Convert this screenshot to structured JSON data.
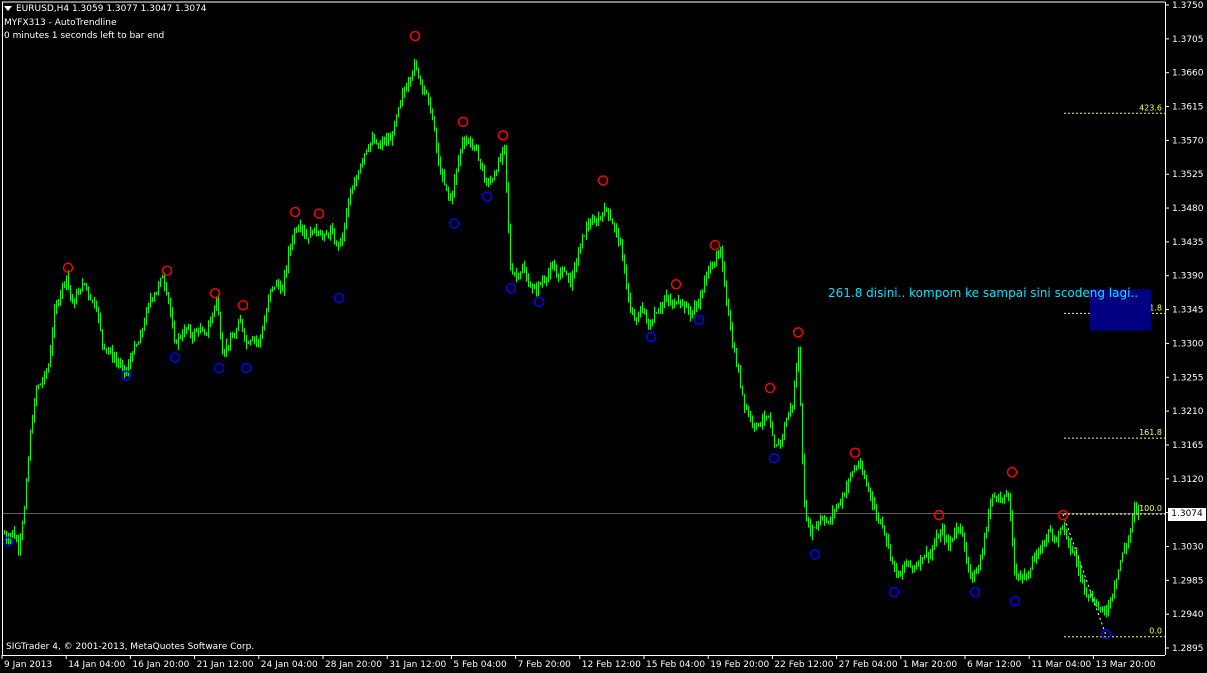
{
  "header": {
    "symbol_line": "EURUSD,H4  1.3059 1.3077 1.3047 1.3074",
    "indicator": "MYFX313 - AutoTrendline",
    "timer": "0 minutes 1 seconds left to bar end"
  },
  "copyright": "SIGTrader 4, © 2001-2013, MetaQuotes Software Corp.",
  "annotation": "261.8 disini.. kompom ke sampai sini scodeng lagi..",
  "last_price_label": "1.3074",
  "colors": {
    "background": "#000000",
    "candles": "#00ff00",
    "swing_high": "#ff0000",
    "swing_low": "#0000ff",
    "fib": "#ffff66",
    "annotation": "#00e5ff",
    "box": "#000080"
  },
  "chart_data": {
    "type": "line",
    "style": "candlestick",
    "ylim": [
      1.2895,
      1.375
    ],
    "y_ticks": [
      "1.3750",
      "1.3705",
      "1.3660",
      "1.3615",
      "1.3570",
      "1.3525",
      "1.3480",
      "1.3435",
      "1.3390",
      "1.3345",
      "1.3300",
      "1.3255",
      "1.3210",
      "1.3165",
      "1.3120",
      "1.3075",
      "1.3030",
      "1.2985",
      "1.2940",
      "1.2895"
    ],
    "x_ticks": [
      "9 Jan 2013",
      "14 Jan 04:00",
      "16 Jan 20:00",
      "21 Jan 12:00",
      "24 Jan 04:00",
      "28 Jan 20:00",
      "31 Jan 12:00",
      "5 Feb 04:00",
      "7 Feb 20:00",
      "12 Feb 12:00",
      "15 Feb 04:00",
      "19 Feb 20:00",
      "22 Feb 12:00",
      "27 Feb 04:00",
      "1 Mar 20:00",
      "6 Mar 12:00",
      "11 Mar 04:00",
      "13 Mar 20:00"
    ],
    "close_series": [
      [
        0,
        1.306
      ],
      [
        6,
        1.304
      ],
      [
        12,
        1.305
      ],
      [
        18,
        1.303
      ],
      [
        24,
        1.308
      ],
      [
        30,
        1.318
      ],
      [
        36,
        1.324
      ],
      [
        42,
        1.325
      ],
      [
        48,
        1.327
      ],
      [
        54,
        1.334
      ],
      [
        60,
        1.337
      ],
      [
        66,
        1.339
      ],
      [
        72,
        1.335
      ],
      [
        78,
        1.337
      ],
      [
        84,
        1.338
      ],
      [
        90,
        1.336
      ],
      [
        96,
        1.335
      ],
      [
        102,
        1.33
      ],
      [
        108,
        1.329
      ],
      [
        114,
        1.328
      ],
      [
        120,
        1.327
      ],
      [
        126,
        1.326
      ],
      [
        132,
        1.329
      ],
      [
        138,
        1.33
      ],
      [
        144,
        1.333
      ],
      [
        150,
        1.336
      ],
      [
        156,
        1.337
      ],
      [
        162,
        1.339
      ],
      [
        168,
        1.336
      ],
      [
        174,
        1.33
      ],
      [
        180,
        1.331
      ],
      [
        186,
        1.332
      ],
      [
        192,
        1.331
      ],
      [
        198,
        1.332
      ],
      [
        204,
        1.331
      ],
      [
        210,
        1.333
      ],
      [
        216,
        1.336
      ],
      [
        222,
        1.329
      ],
      [
        228,
        1.33
      ],
      [
        234,
        1.331
      ],
      [
        240,
        1.333
      ],
      [
        246,
        1.33
      ],
      [
        252,
        1.331
      ],
      [
        258,
        1.33
      ],
      [
        264,
        1.333
      ],
      [
        270,
        1.337
      ],
      [
        276,
        1.338
      ],
      [
        282,
        1.337
      ],
      [
        288,
        1.342
      ],
      [
        294,
        1.345
      ],
      [
        300,
        1.346
      ],
      [
        306,
        1.344
      ],
      [
        312,
        1.345
      ],
      [
        318,
        1.345
      ],
      [
        324,
        1.344
      ],
      [
        330,
        1.345
      ],
      [
        336,
        1.343
      ],
      [
        342,
        1.344
      ],
      [
        348,
        1.349
      ],
      [
        354,
        1.351
      ],
      [
        360,
        1.354
      ],
      [
        366,
        1.356
      ],
      [
        372,
        1.357
      ],
      [
        378,
        1.356
      ],
      [
        384,
        1.357
      ],
      [
        390,
        1.357
      ],
      [
        396,
        1.36
      ],
      [
        402,
        1.363
      ],
      [
        408,
        1.365
      ],
      [
        414,
        1.367
      ],
      [
        420,
        1.365
      ],
      [
        426,
        1.363
      ],
      [
        432,
        1.36
      ],
      [
        438,
        1.354
      ],
      [
        444,
        1.351
      ],
      [
        450,
        1.349
      ],
      [
        456,
        1.353
      ],
      [
        462,
        1.357
      ],
      [
        468,
        1.357
      ],
      [
        474,
        1.356
      ],
      [
        480,
        1.354
      ],
      [
        486,
        1.351
      ],
      [
        492,
        1.352
      ],
      [
        498,
        1.354
      ],
      [
        504,
        1.356
      ],
      [
        510,
        1.34
      ],
      [
        516,
        1.339
      ],
      [
        522,
        1.34
      ],
      [
        528,
        1.338
      ],
      [
        534,
        1.337
      ],
      [
        540,
        1.338
      ],
      [
        546,
        1.339
      ],
      [
        552,
        1.34
      ],
      [
        558,
        1.339
      ],
      [
        564,
        1.34
      ],
      [
        570,
        1.338
      ],
      [
        576,
        1.341
      ],
      [
        582,
        1.344
      ],
      [
        588,
        1.346
      ],
      [
        594,
        1.346
      ],
      [
        600,
        1.347
      ],
      [
        606,
        1.348
      ],
      [
        612,
        1.346
      ],
      [
        618,
        1.344
      ],
      [
        624,
        1.34
      ],
      [
        630,
        1.334
      ],
      [
        636,
        1.333
      ],
      [
        642,
        1.335
      ],
      [
        648,
        1.332
      ],
      [
        654,
        1.334
      ],
      [
        660,
        1.335
      ],
      [
        666,
        1.336
      ],
      [
        672,
        1.335
      ],
      [
        678,
        1.336
      ],
      [
        684,
        1.335
      ],
      [
        690,
        1.334
      ],
      [
        696,
        1.335
      ],
      [
        702,
        1.337
      ],
      [
        708,
        1.34
      ],
      [
        714,
        1.341
      ],
      [
        720,
        1.342
      ],
      [
        726,
        1.336
      ],
      [
        732,
        1.33
      ],
      [
        738,
        1.326
      ],
      [
        744,
        1.322
      ],
      [
        750,
        1.32
      ],
      [
        756,
        1.319
      ],
      [
        762,
        1.32
      ],
      [
        768,
        1.32
      ],
      [
        774,
        1.316
      ],
      [
        780,
        1.317
      ],
      [
        786,
        1.32
      ],
      [
        792,
        1.322
      ],
      [
        798,
        1.329
      ],
      [
        804,
        1.308
      ],
      [
        810,
        1.305
      ],
      [
        816,
        1.306
      ],
      [
        822,
        1.307
      ],
      [
        828,
        1.306
      ],
      [
        834,
        1.308
      ],
      [
        840,
        1.309
      ],
      [
        846,
        1.311
      ],
      [
        852,
        1.313
      ],
      [
        858,
        1.314
      ],
      [
        864,
        1.312
      ],
      [
        870,
        1.31
      ],
      [
        876,
        1.307
      ],
      [
        882,
        1.306
      ],
      [
        888,
        1.303
      ],
      [
        894,
        1.3
      ],
      [
        900,
        1.299
      ],
      [
        906,
        1.301
      ],
      [
        912,
        1.3
      ],
      [
        918,
        1.301
      ],
      [
        924,
        1.302
      ],
      [
        930,
        1.302
      ],
      [
        936,
        1.304
      ],
      [
        942,
        1.305
      ],
      [
        948,
        1.303
      ],
      [
        954,
        1.305
      ],
      [
        960,
        1.306
      ],
      [
        966,
        1.301
      ],
      [
        972,
        1.299
      ],
      [
        978,
        1.3
      ],
      [
        984,
        1.304
      ],
      [
        990,
        1.309
      ],
      [
        996,
        1.31
      ],
      [
        1002,
        1.309
      ],
      [
        1008,
        1.31
      ],
      [
        1014,
        1.3
      ],
      [
        1020,
        1.299
      ],
      [
        1026,
        1.299
      ],
      [
        1032,
        1.301
      ],
      [
        1038,
        1.302
      ],
      [
        1044,
        1.304
      ],
      [
        1050,
        1.305
      ],
      [
        1056,
        1.304
      ],
      [
        1062,
        1.306
      ],
      [
        1068,
        1.303
      ],
      [
        1074,
        1.302
      ],
      [
        1080,
        1.299
      ],
      [
        1086,
        1.297
      ],
      [
        1092,
        1.296
      ],
      [
        1098,
        1.295
      ],
      [
        1104,
        1.294
      ],
      [
        1110,
        1.296
      ],
      [
        1116,
        1.299
      ],
      [
        1122,
        1.302
      ],
      [
        1128,
        1.304
      ],
      [
        1134,
        1.308
      ],
      [
        1138,
        1.3074
      ]
    ],
    "swing_highs": [
      [
        68,
        1.3402
      ],
      [
        167,
        1.3398
      ],
      [
        215,
        1.3368
      ],
      [
        243,
        1.3352
      ],
      [
        295,
        1.3476
      ],
      [
        319,
        1.3474
      ],
      [
        415,
        1.371
      ],
      [
        463,
        1.3596
      ],
      [
        503,
        1.3578
      ],
      [
        603,
        1.3518
      ],
      [
        676,
        1.338
      ],
      [
        715,
        1.3432
      ],
      [
        770,
        1.3242
      ],
      [
        798,
        1.3316
      ],
      [
        855,
        1.3156
      ],
      [
        939,
        1.3073
      ],
      [
        1012,
        1.313
      ],
      [
        1063,
        1.3073
      ]
    ],
    "swing_lows": [
      [
        8,
        1.3035
      ],
      [
        126,
        1.3256
      ],
      [
        175,
        1.328
      ],
      [
        219,
        1.3266
      ],
      [
        246,
        1.3266
      ],
      [
        339,
        1.3359
      ],
      [
        454,
        1.3458
      ],
      [
        487,
        1.3494
      ],
      [
        511,
        1.3372
      ],
      [
        539,
        1.3354
      ],
      [
        651,
        1.3307
      ],
      [
        699,
        1.333
      ],
      [
        774,
        1.3146
      ],
      [
        815,
        1.3018
      ],
      [
        894,
        1.2968
      ],
      [
        975,
        1.2968
      ],
      [
        1015,
        1.2956
      ],
      [
        1106,
        1.2912
      ]
    ],
    "fibonacci": [
      {
        "level": "423.6",
        "price": 1.3606
      },
      {
        "level": "261.8",
        "price": 1.334
      },
      {
        "level": "161.8",
        "price": 1.3174
      },
      {
        "level": "100.0",
        "price": 1.3073
      },
      {
        "level": "0.0",
        "price": 1.291
      }
    ],
    "last_price": 1.3074,
    "box_price_range": [
      1.3317,
      1.3372
    ]
  }
}
